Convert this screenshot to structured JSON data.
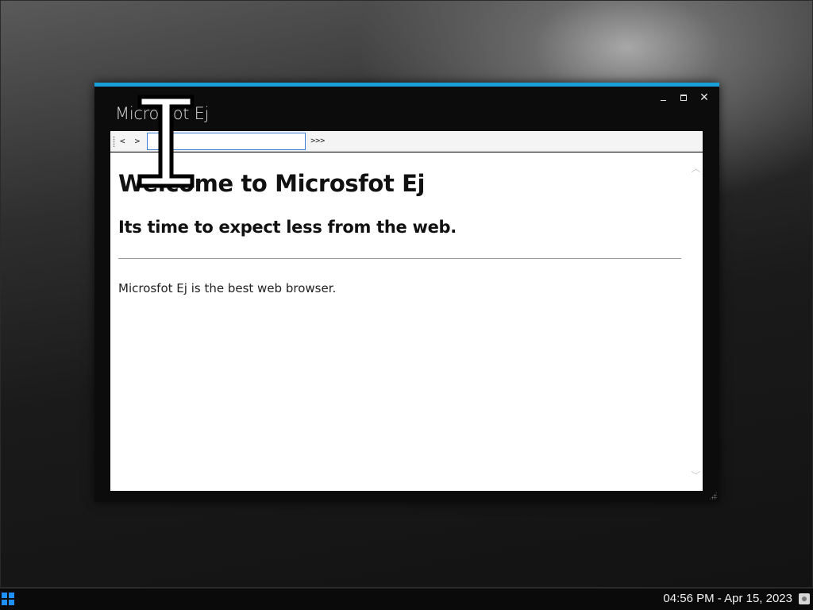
{
  "window": {
    "title": "Microsfot Ej",
    "accent_color": "#1aa0d8"
  },
  "toolbar": {
    "back_label": "<",
    "forward_label": ">",
    "address_value": "",
    "go_label": ">>>"
  },
  "page": {
    "heading": "Welcome to Microsfot Ej",
    "subheading": "Its time to expect less from the web.",
    "body": "Microsfot Ej is the best web browser."
  },
  "taskbar": {
    "clock": "04:56 PM - Apr 15, 2023",
    "start_color": "#1e90ff"
  },
  "icons": [
    "minimize-icon",
    "maximize-icon",
    "close-icon",
    "scroll-up-icon",
    "scroll-down-icon",
    "resize-grip-icon",
    "start-icon",
    "tray-user-icon",
    "ibeam-cursor-icon"
  ]
}
